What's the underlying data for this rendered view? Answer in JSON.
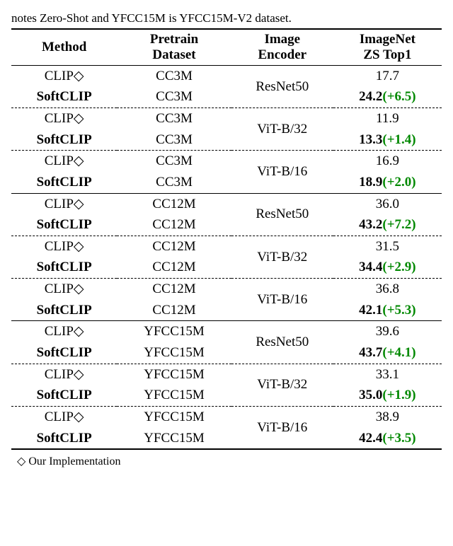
{
  "caption": "notes Zero-Shot and YFCC15M is YFCC15M-V2 dataset.",
  "headers": {
    "method": "Method",
    "pretrain_a": "Pretrain",
    "pretrain_b": "Dataset",
    "encoder_a": "Image",
    "encoder_b": "Encoder",
    "zs_a": "ImageNet",
    "zs_b": "ZS Top1"
  },
  "methods": {
    "clip": "CLIP",
    "softclip": "SoftCLIP",
    "diamond": "◇"
  },
  "datasets": {
    "cc3m": "CC3M",
    "cc12m": "CC12M",
    "yfcc": "YFCC15M"
  },
  "encoders": {
    "r50": "ResNet50",
    "vit32": "ViT-B/32",
    "vit16": "ViT-B/16"
  },
  "rows": {
    "r1": {
      "base": "17.7",
      "soft": "24.2",
      "delta": "(+6.5)"
    },
    "r2": {
      "base": "11.9",
      "soft": "13.3",
      "delta": "(+1.4)"
    },
    "r3": {
      "base": "16.9",
      "soft": "18.9",
      "delta": "(+2.0)"
    },
    "r4": {
      "base": "36.0",
      "soft": "43.2",
      "delta": "(+7.2)"
    },
    "r5": {
      "base": "31.5",
      "soft": "34.4",
      "delta": "(+2.9)"
    },
    "r6": {
      "base": "36.8",
      "soft": "42.1",
      "delta": "(+5.3)"
    },
    "r7": {
      "base": "39.6",
      "soft": "43.7",
      "delta": "(+4.1)"
    },
    "r8": {
      "base": "33.1",
      "soft": "35.0",
      "delta": "(+1.9)"
    },
    "r9": {
      "base": "38.9",
      "soft": "42.4",
      "delta": "(+3.5)"
    }
  },
  "footnote": {
    "diamond": "◇",
    "text": " Our Implementation"
  },
  "chart_data": {
    "type": "table",
    "title": "ImageNet Zero-Shot Top1 comparison",
    "columns": [
      "Method",
      "Pretrain Dataset",
      "Image Encoder",
      "ImageNet ZS Top1"
    ],
    "rows": [
      [
        "CLIP◇",
        "CC3M",
        "ResNet50",
        17.7
      ],
      [
        "SoftCLIP",
        "CC3M",
        "ResNet50",
        24.2
      ],
      [
        "CLIP◇",
        "CC3M",
        "ViT-B/32",
        11.9
      ],
      [
        "SoftCLIP",
        "CC3M",
        "ViT-B/32",
        13.3
      ],
      [
        "CLIP◇",
        "CC3M",
        "ViT-B/16",
        16.9
      ],
      [
        "SoftCLIP",
        "CC3M",
        "ViT-B/16",
        18.9
      ],
      [
        "CLIP◇",
        "CC12M",
        "ResNet50",
        36.0
      ],
      [
        "SoftCLIP",
        "CC12M",
        "ResNet50",
        43.2
      ],
      [
        "CLIP◇",
        "CC12M",
        "ViT-B/32",
        31.5
      ],
      [
        "SoftCLIP",
        "CC12M",
        "ViT-B/32",
        34.4
      ],
      [
        "CLIP◇",
        "CC12M",
        "ViT-B/16",
        36.8
      ],
      [
        "SoftCLIP",
        "CC12M",
        "ViT-B/16",
        42.1
      ],
      [
        "CLIP◇",
        "YFCC15M",
        "ResNet50",
        39.6
      ],
      [
        "SoftCLIP",
        "YFCC15M",
        "ResNet50",
        43.7
      ],
      [
        "CLIP◇",
        "YFCC15M",
        "ViT-B/32",
        33.1
      ],
      [
        "SoftCLIP",
        "YFCC15M",
        "ViT-B/32",
        35.0
      ],
      [
        "CLIP◇",
        "YFCC15M",
        "ViT-B/16",
        38.9
      ],
      [
        "SoftCLIP",
        "YFCC15M",
        "ViT-B/16",
        42.4
      ]
    ]
  }
}
